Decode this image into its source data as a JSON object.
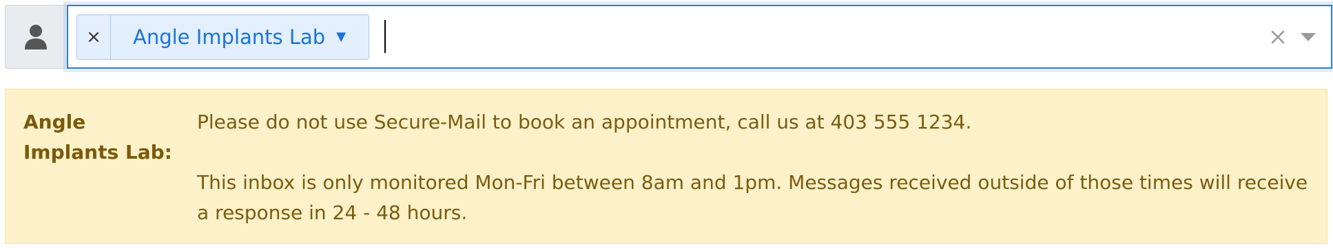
{
  "recipient": {
    "selected_chip": {
      "label": "Angle Implants Lab",
      "remove_glyph": "×",
      "caret_glyph": "▼"
    },
    "input_value": "",
    "icons": {
      "addon": "user-icon",
      "clear": "clear-icon",
      "dropdown": "chevron-down-icon"
    },
    "colors": {
      "focus_border": "#2b7cd3",
      "chip_text": "#1a73d9",
      "chip_bg": "#e3effc"
    }
  },
  "notice": {
    "title": "Angle Implants Lab:",
    "paragraphs": [
      "Please do not use Secure-Mail to book an appointment, call us at 403 555 1234.",
      "This inbox is only monitored Mon-Fri between 8am and 1pm.  Messages received outside of those times will receive a response in 24 - 48 hours."
    ],
    "colors": {
      "background": "#fcf1c9",
      "text": "#7a5c0f"
    }
  }
}
